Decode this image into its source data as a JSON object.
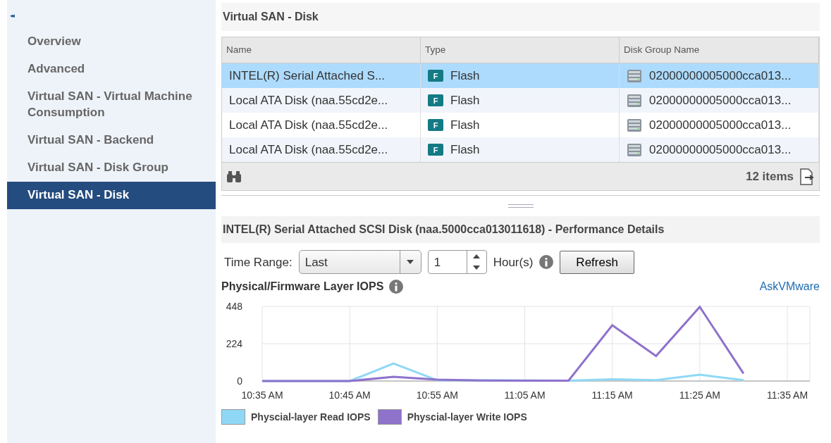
{
  "sidebar": {
    "collapse_glyph": "◂◂",
    "items": [
      {
        "label": "Overview",
        "selected": false
      },
      {
        "label": "Advanced",
        "selected": false
      },
      {
        "label": "Virtual SAN - Virtual Machine Consumption",
        "selected": false
      },
      {
        "label": "Virtual SAN - Backend",
        "selected": false
      },
      {
        "label": "Virtual SAN - Disk Group",
        "selected": false
      },
      {
        "label": "Virtual SAN - Disk",
        "selected": true
      }
    ]
  },
  "panel_title": "Virtual SAN - Disk",
  "table": {
    "columns": [
      "Name",
      "Type",
      "Disk Group Name"
    ],
    "rows": [
      {
        "name": "INTEL(R) Serial Attached S...",
        "type_badge": "F",
        "type": "Flash",
        "disk_group": "02000000005000cca013...",
        "selected": true
      },
      {
        "name": "Local ATA Disk (naa.55cd2e...",
        "type_badge": "F",
        "type": "Flash",
        "disk_group": "02000000005000cca013...",
        "selected": false
      },
      {
        "name": "Local ATA Disk (naa.55cd2e...",
        "type_badge": "F",
        "type": "Flash",
        "disk_group": "02000000005000cca013...",
        "selected": false
      },
      {
        "name": "Local ATA Disk (naa.55cd2e...",
        "type_badge": "F",
        "type": "Flash",
        "disk_group": "02000000005000cca013...",
        "selected": false
      }
    ],
    "item_count": "12 items"
  },
  "details": {
    "title": "INTEL(R) Serial Attached SCSI Disk (naa.5000cca013011618) - Performance Details",
    "time_range_label": "Time Range:",
    "time_range_value": "Last",
    "amount_value": "1",
    "unit_label": "Hour(s)",
    "refresh_button": "Refresh",
    "chart_title": "Physical/Firmware Layer IOPS",
    "link": "AskVMware",
    "chart_data": {
      "type": "line",
      "categories": [
        "10:35 AM",
        null,
        "10:45 AM",
        null,
        "10:55 AM",
        null,
        "11:05 AM",
        null,
        "11:15 AM",
        null,
        "11:25 AM",
        null,
        "11:35 AM"
      ],
      "ylim": [
        0,
        448
      ],
      "yticks": [
        0,
        224,
        448
      ],
      "grid": true,
      "series": [
        {
          "name": "Physcial-layer Read IOPS",
          "color": "#8fd8f5",
          "values": [
            0,
            0,
            0,
            105,
            5,
            null,
            null,
            2,
            10,
            5,
            38,
            5,
            null
          ]
        },
        {
          "name": "Physcial-layer Write IOPS",
          "color": "#8e72cc",
          "values": [
            0,
            0,
            0,
            25,
            8,
            3,
            2,
            2,
            335,
            150,
            445,
            45,
            null
          ]
        }
      ]
    }
  }
}
